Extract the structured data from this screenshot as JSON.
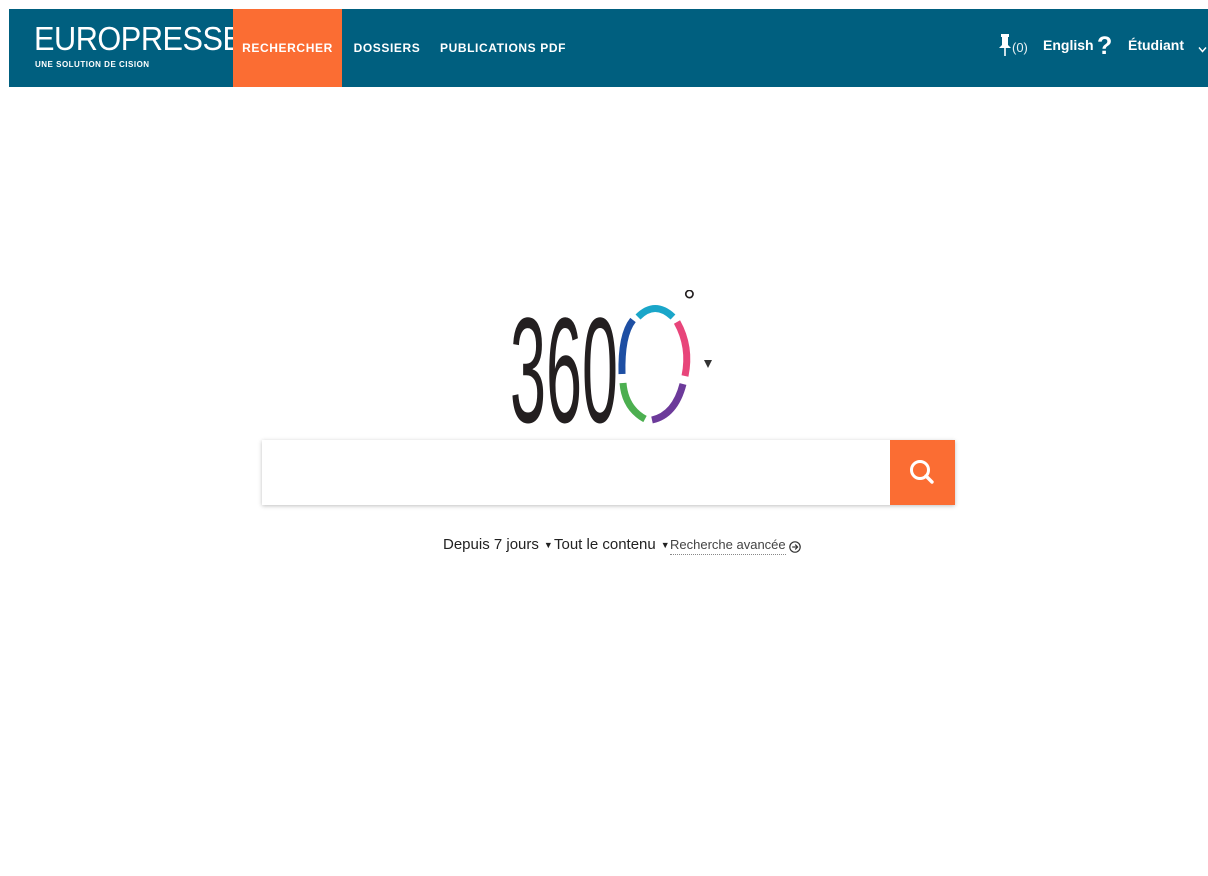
{
  "header": {
    "brand_name": "EUROPRESSE",
    "brand_tagline": "UNE SOLUTION DE CISION",
    "nav": [
      {
        "label": "RECHERCHER",
        "active": true
      },
      {
        "label": "DOSSIERS",
        "active": false
      },
      {
        "label": "PUBLICATIONS PDF",
        "active": false
      }
    ],
    "pinned_count": "(0)",
    "language_link": "English",
    "help_label": "?",
    "user_label": "Étudiant"
  },
  "logo": {
    "text": "360",
    "degree": "°"
  },
  "search": {
    "value": "",
    "placeholder": ""
  },
  "filters": {
    "period": "Depuis 7 jours",
    "content": "Tout le contenu",
    "advanced": "Recherche avancée"
  },
  "colors": {
    "header_bg": "#005f7f",
    "accent": "#fb6d33",
    "logo_ring": [
      "#1aa6c9",
      "#e8457a",
      "#6c3a9a",
      "#4caf50",
      "#1e4fa3"
    ]
  },
  "icons": {
    "pin": "pin-icon",
    "help": "help-icon",
    "chevron": "chevron-down-icon",
    "search": "search-icon",
    "caret": "caret-down-icon",
    "advanced": "arrow-circle-right-icon"
  }
}
